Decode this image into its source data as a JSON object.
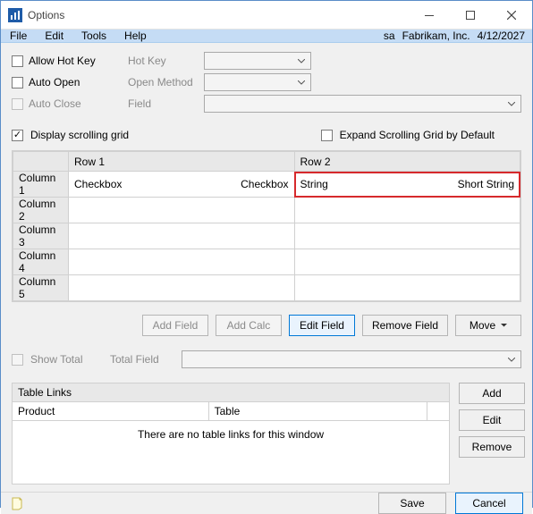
{
  "window": {
    "title": "Options"
  },
  "menubar": {
    "file": "File",
    "edit": "Edit",
    "tools": "Tools",
    "help": "Help",
    "user": "sa",
    "company": "Fabrikam, Inc.",
    "date": "4/12/2027"
  },
  "allow_hot_key": {
    "label": "Allow Hot Key",
    "hotkey_label": "Hot Key"
  },
  "auto_open": {
    "label": "Auto Open",
    "method_label": "Open Method"
  },
  "auto_close": {
    "label": "Auto Close",
    "field_label": "Field"
  },
  "display_scrolling_grid": {
    "label": "Display scrolling grid"
  },
  "expand_default": {
    "label": "Expand Scrolling Grid by Default"
  },
  "grid": {
    "row1": "Row 1",
    "row2": "Row 2",
    "col1": "Column 1",
    "col2": "Column 2",
    "col3": "Column 3",
    "col4": "Column 4",
    "col5": "Column 5",
    "r1c1_left": "Checkbox",
    "r1c1_right": "Checkbox",
    "r1c2_left": "String",
    "r1c2_right": "Short String"
  },
  "buttons": {
    "add_field": "Add Field",
    "add_calc": "Add Calc",
    "edit_field": "Edit Field",
    "remove_field": "Remove Field",
    "move": "Move"
  },
  "show_total": {
    "label": "Show Total",
    "total_field_label": "Total Field"
  },
  "table_links": {
    "title": "Table Links",
    "product_col": "Product",
    "table_col": "Table",
    "empty": "There are no table links for this window"
  },
  "side": {
    "add": "Add",
    "edit": "Edit",
    "remove": "Remove"
  },
  "footer": {
    "save": "Save",
    "cancel": "Cancel"
  }
}
